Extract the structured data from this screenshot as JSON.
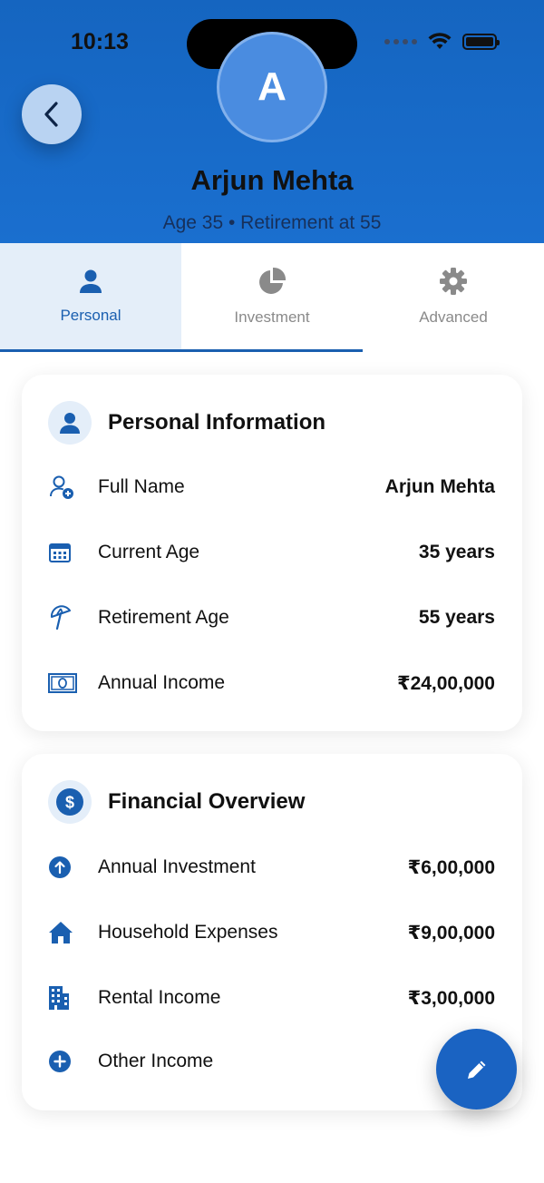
{
  "status_bar": {
    "time": "10:13"
  },
  "profile": {
    "avatar_initial": "A",
    "name": "Arjun Mehta",
    "subtitle": "Age 35 • Retirement at 55"
  },
  "tabs": [
    {
      "label": "Personal",
      "icon": "person-icon",
      "active": true
    },
    {
      "label": "Investment",
      "icon": "pie-chart-icon",
      "active": false
    },
    {
      "label": "Advanced",
      "icon": "gear-icon",
      "active": false
    }
  ],
  "personal_info": {
    "title": "Personal Information",
    "icon": "person-icon",
    "rows": [
      {
        "icon": "person-add-icon",
        "label": "Full Name",
        "value": "Arjun Mehta"
      },
      {
        "icon": "calendar-icon",
        "label": "Current Age",
        "value": "35 years"
      },
      {
        "icon": "beach-umbrella-icon",
        "label": "Retirement Age",
        "value": "55 years"
      },
      {
        "icon": "money-bill-icon",
        "label": "Annual Income",
        "value": "₹24,00,000"
      }
    ]
  },
  "financial_overview": {
    "title": "Financial Overview",
    "icon": "dollar-circle-icon",
    "rows": [
      {
        "icon": "arrow-up-circle-icon",
        "label": "Annual Investment",
        "value": "₹6,00,000"
      },
      {
        "icon": "house-icon",
        "label": "Household Expenses",
        "value": "₹9,00,000"
      },
      {
        "icon": "building-icon",
        "label": "Rental Income",
        "value": "₹3,00,000"
      },
      {
        "icon": "plus-circle-icon",
        "label": "Other Income",
        "value": ""
      }
    ]
  },
  "colors": {
    "primary": "#1565c0",
    "accent": "#1a5fb0",
    "tab_active_bg": "#e4eef9",
    "fab": "#1a63c2"
  }
}
